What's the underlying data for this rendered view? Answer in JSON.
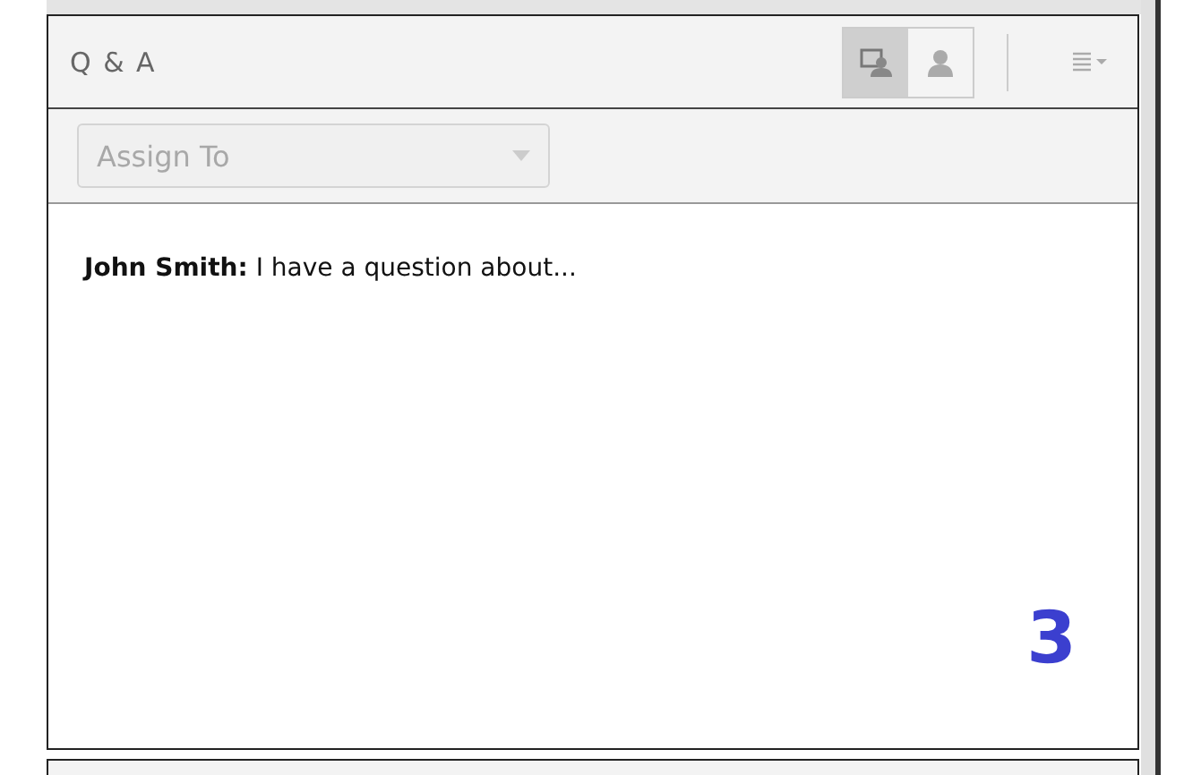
{
  "panel": {
    "title": "Q & A"
  },
  "view_buttons": [
    {
      "kind": "presenter",
      "selected": true
    },
    {
      "kind": "attendee",
      "selected": false
    }
  ],
  "assign": {
    "placeholder": "Assign To",
    "disabled": true
  },
  "messages": [
    {
      "author": "John Smith:",
      "text": "I have a question about..."
    }
  ],
  "callout": "3"
}
